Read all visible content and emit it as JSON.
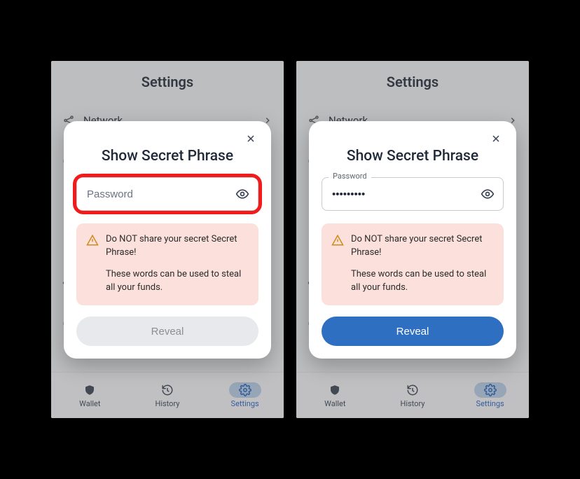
{
  "ui": {
    "page_title": "Settings",
    "settings_items": [
      "Network"
    ],
    "modal_title": "Show Secret Phrase",
    "password_label": "Password",
    "password_placeholder": "Password",
    "password_value_masked": "•••••••••",
    "warning_line1": "Do NOT share your secret Secret Phrase!",
    "warning_line2": "These words can be used to steal all your funds.",
    "reveal_label": "Reveal",
    "nav": {
      "wallet": "Wallet",
      "history": "History",
      "settings": "Settings"
    }
  },
  "colors": {
    "accent": "#2f6fc1",
    "highlight": "#f11b1b",
    "warn_bg": "#fbe0dc"
  }
}
